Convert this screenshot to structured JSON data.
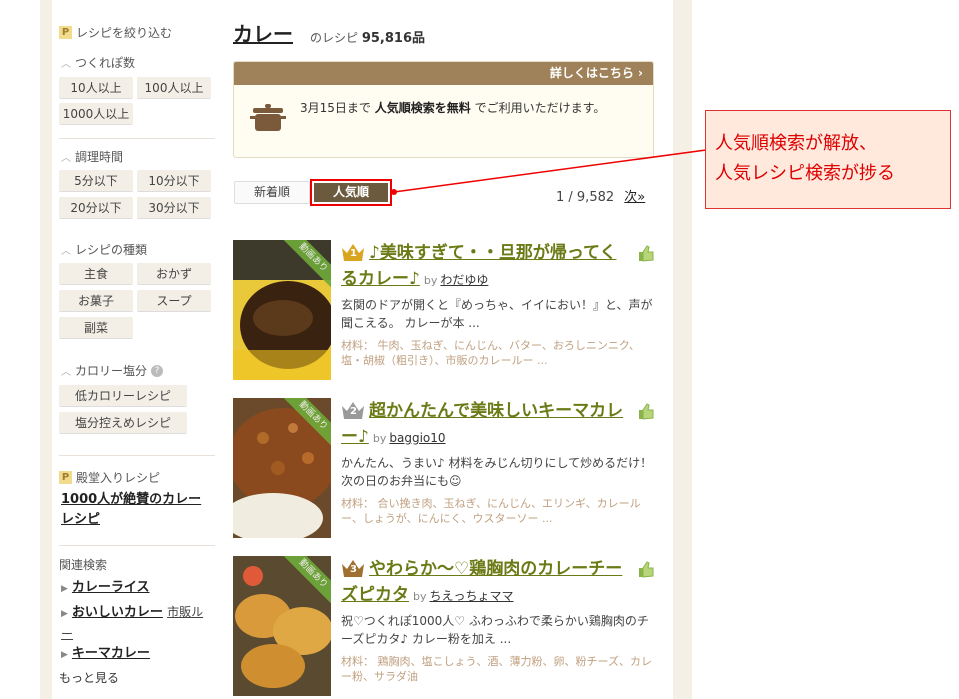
{
  "sidebar": {
    "filter_title": "レシピを絞り込む",
    "tsukurepo": {
      "title": "つくれぽ数",
      "options": [
        "10人以上",
        "100人以上",
        "1000人以上"
      ]
    },
    "cook_time": {
      "title": "調理時間",
      "options": [
        "5分以下",
        "10分以下",
        "20分以下",
        "30分以下"
      ]
    },
    "recipe_type": {
      "title": "レシピの種類",
      "options": [
        "主食",
        "おかず",
        "お菓子",
        "スープ",
        "副菜"
      ]
    },
    "calorie": {
      "title": "カロリー塩分",
      "options": [
        "低カロリーレシピ",
        "塩分控えめレシピ"
      ]
    },
    "hall_of_fame": {
      "title": "殿堂入りレシピ",
      "link": "1000人が絶賛のカレーレシピ"
    },
    "related": {
      "title": "関連検索",
      "items": [
        {
          "label": "カレーライス",
          "sub": ""
        },
        {
          "label": "おいしいカレー",
          "sub": "市販ルー"
        },
        {
          "label": "キーマカレー",
          "sub": ""
        }
      ],
      "more": "もっと見る"
    }
  },
  "header": {
    "keyword": "カレー",
    "suffix": "のレシピ",
    "count": "95,816品"
  },
  "notice": {
    "link": "詳しくはこちら ›",
    "date": "3月15日まで",
    "highlight": "人気順検索を無料",
    "rest": "でご利用いただけます。"
  },
  "sort": {
    "new_label": "新着順",
    "popular_label": "人気順",
    "page": "1 / 9,582",
    "next": "次»"
  },
  "badge": "動画あり",
  "recipes": [
    {
      "rank": "1",
      "title": "♪美味すぎて・・旦那が帰ってくるカレー♪",
      "author": "わだゆゆ",
      "desc": "玄関のドアが開くと『めっちゃ、イイにおい！』と、声が聞こえる。 カレーが本 ...",
      "ingredients": "材料： 牛肉、玉ねぎ、にんじん、バター、おろしニンニク、塩・胡椒（粗引き）、市販のカレールー ..."
    },
    {
      "rank": "2",
      "title": "超かんたんで美味しいキーマカレー♪",
      "author": "baggio10",
      "desc": "かんたん、うまい♪ 材料をみじん切りにして炒めるだけ！ 次の日のお弁当にも☺",
      "ingredients": "材料： 合い挽き肉、玉ねぎ、にんじん、エリンギ、カレールー、しょうが、にんにく、ウスターソー ..."
    },
    {
      "rank": "3",
      "title": "やわらか～♡鶏胸肉のカレーチーズピカタ",
      "author": "ちえっちょママ",
      "desc": "祝♡つくれぽ1000人♡ ふわっふわで柔らかい鶏胸肉のチーズピカタ♪ カレー粉を加え ...",
      "ingredients": "材料： 鶏胸肉、塩こしょう、酒、薄力粉、卵、粉チーズ、カレー粉、サラダ油"
    }
  ],
  "annotation": {
    "line1": "人気順検索が解放、",
    "line2": "人気レシピ検索が捗る"
  },
  "colors": {
    "accent_brown": "#a0825a",
    "title_green": "#6b7a14",
    "annotation_red": "#dd0000"
  }
}
